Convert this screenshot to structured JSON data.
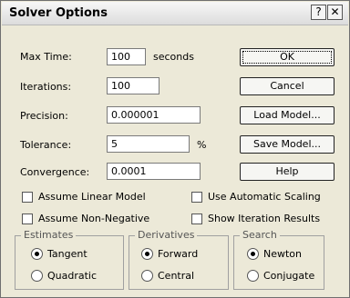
{
  "window": {
    "title": "Solver Options",
    "help_glyph": "?",
    "close_glyph": "✕"
  },
  "fields": {
    "max_time_label": "Max Time:",
    "max_time_value": "100",
    "seconds_unit": "seconds",
    "iterations_label": "Iterations:",
    "iterations_value": "100",
    "precision_label": "Precision:",
    "precision_value": "0.000001",
    "tolerance_label": "Tolerance:",
    "tolerance_value": "5",
    "percent_unit": "%",
    "convergence_label": "Convergence:",
    "convergence_value": "0.0001"
  },
  "buttons": {
    "ok": "OK",
    "cancel": "Cancel",
    "load_model": "Load Model...",
    "save_model": "Save Model...",
    "help": "Help"
  },
  "checkboxes": {
    "assume_linear_model": {
      "label": "Assume Linear Model",
      "checked": false
    },
    "assume_non_negative": {
      "label": "Assume Non-Negative",
      "checked": false
    },
    "use_automatic_scaling": {
      "label": "Use Automatic Scaling",
      "checked": false
    },
    "show_iteration_results": {
      "label": "Show Iteration Results",
      "checked": false
    }
  },
  "groups": {
    "estimates": {
      "title": "Estimates",
      "options": [
        "Tangent",
        "Quadratic"
      ],
      "selected": "Tangent"
    },
    "derivatives": {
      "title": "Derivatives",
      "options": [
        "Forward",
        "Central"
      ],
      "selected": "Forward"
    },
    "search": {
      "title": "Search",
      "options": [
        "Newton",
        "Conjugate"
      ],
      "selected": "Newton"
    }
  }
}
